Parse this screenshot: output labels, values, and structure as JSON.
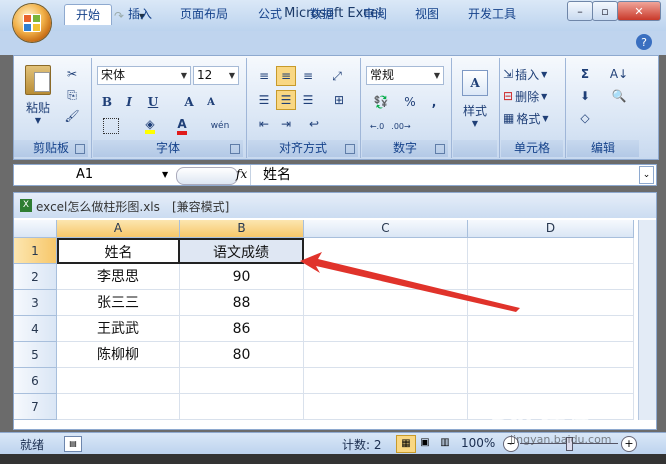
{
  "window": {
    "title": "Microsoft Excel",
    "controls": {
      "minimize": "–",
      "restore": "▫",
      "close": "✕"
    }
  },
  "qat": {
    "save_icon": "💾",
    "undo_icon": "↶",
    "redo_icon": "↷",
    "customize_icon": "▾"
  },
  "tabs": [
    "开始",
    "插入",
    "页面布局",
    "公式",
    "数据",
    "审阅",
    "视图",
    "开发工具"
  ],
  "ribbon": {
    "clipboard": {
      "label": "剪贴板",
      "paste": "粘贴"
    },
    "font": {
      "label": "字体",
      "font_name": "宋体",
      "font_size": "12",
      "bold": "B",
      "italic": "I",
      "underline": "U",
      "grow": "A",
      "shrink": "A",
      "font_color": "A",
      "phonetic": "wén"
    },
    "alignment": {
      "label": "对齐方式"
    },
    "number": {
      "label": "数字",
      "format": "常规",
      "percent": "%",
      "comma": ","
    },
    "styles": {
      "label": "",
      "button": "样式"
    },
    "cells": {
      "label": "单元格",
      "insert": "插入",
      "delete": "删除",
      "format": "格式"
    },
    "editing": {
      "label": "编辑",
      "sum": "Σ"
    }
  },
  "formula_bar": {
    "name_box": "A1",
    "fx": "fx",
    "content": "姓名"
  },
  "workbook": {
    "title": "excel怎么做柱形图.xls",
    "mode": "[兼容模式]"
  },
  "sheet": {
    "columns": [
      "A",
      "B",
      "C",
      "D"
    ],
    "rows": [
      "1",
      "2",
      "3",
      "4",
      "5",
      "6",
      "7"
    ],
    "cells": [
      [
        "姓名",
        "语文成绩"
      ],
      [
        "李思思",
        "90"
      ],
      [
        "张三三",
        "88"
      ],
      [
        "王武武",
        "86"
      ],
      [
        "陈柳柳",
        "80"
      ],
      [
        "",
        ""
      ],
      [
        "",
        ""
      ]
    ]
  },
  "status": {
    "ready": "就绪",
    "count": "计数: 2",
    "zoom": "100%"
  },
  "watermark": {
    "text": "Bai 经验",
    "url": "jingyan.baidu.com"
  },
  "colors": {
    "accent": "#15428b",
    "arrow": "#e0332b",
    "selection": "#f7c76a"
  }
}
